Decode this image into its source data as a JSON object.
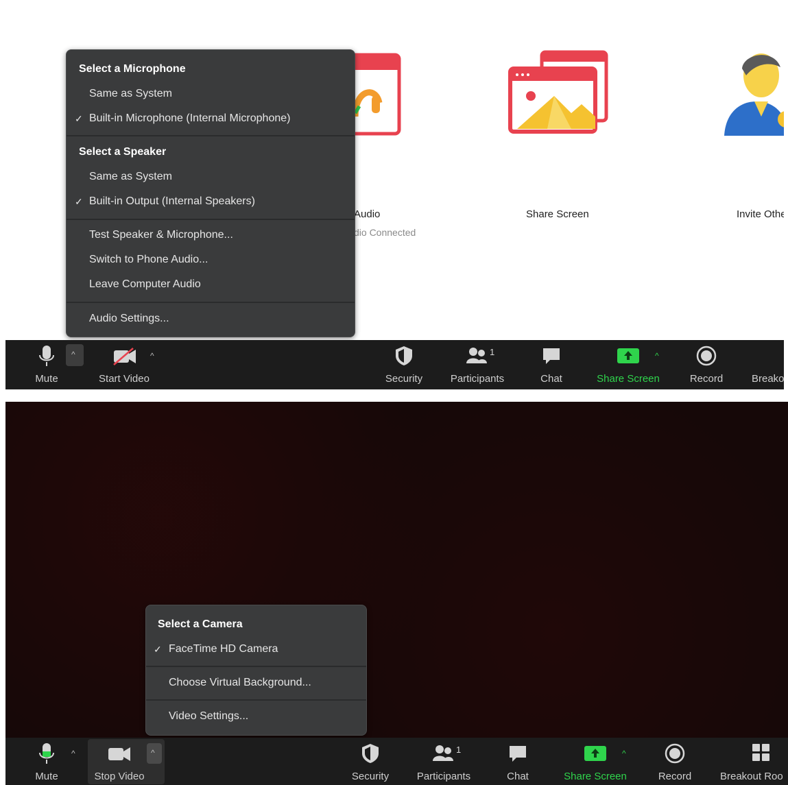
{
  "panel1": {
    "tiles": {
      "audio": {
        "label": "Audio",
        "sublabel": "dio Connected"
      },
      "share_screen": {
        "label": "Share Screen"
      },
      "invite": {
        "label": "Invite Othe"
      }
    },
    "audio_menu": {
      "mic_header": "Select a Microphone",
      "mic_items": [
        {
          "label": "Same as System",
          "checked": false
        },
        {
          "label": "Built-in Microphone (Internal Microphone)",
          "checked": true
        }
      ],
      "speaker_header": "Select a Speaker",
      "speaker_items": [
        {
          "label": "Same as System",
          "checked": false
        },
        {
          "label": "Built-in Output (Internal Speakers)",
          "checked": true
        }
      ],
      "actions": [
        "Test Speaker & Microphone...",
        "Switch to Phone Audio...",
        "Leave Computer Audio"
      ],
      "settings": "Audio Settings..."
    },
    "toolbar": {
      "mute": "Mute",
      "start_video": "Start Video",
      "security": "Security",
      "participants": "Participants",
      "participants_count": "1",
      "chat": "Chat",
      "share_screen": "Share Screen",
      "record": "Record",
      "breakout": "Breako"
    }
  },
  "panel2": {
    "camera_menu": {
      "header": "Select a Camera",
      "items": [
        {
          "label": "FaceTime HD Camera",
          "checked": true
        }
      ],
      "virtual_bg": "Choose Virtual Background...",
      "settings": "Video Settings..."
    },
    "toolbar": {
      "mute": "Mute",
      "stop_video": "Stop Video",
      "security": "Security",
      "participants": "Participants",
      "participants_count": "1",
      "chat": "Chat",
      "share_screen": "Share Screen",
      "record": "Record",
      "breakout": "Breakout Roo"
    }
  },
  "colors": {
    "toolbar_bg": "#1c1c1c",
    "menu_bg": "#3a3b3c",
    "share_green": "#2fd44c",
    "tile_red": "#e8424f",
    "mic_green": "#2fd44c"
  },
  "check_mark": "✓",
  "caret": "^"
}
